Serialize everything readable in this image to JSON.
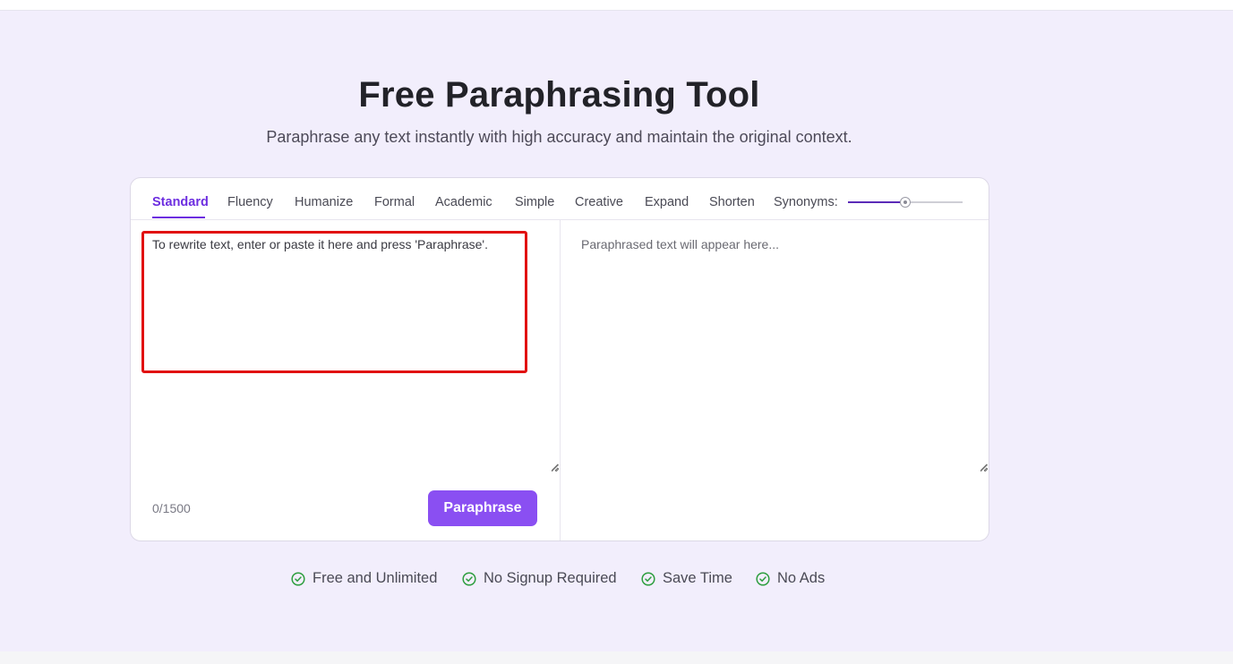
{
  "hero": {
    "title": "Free Paraphrasing Tool",
    "subtitle": "Paraphrase any text instantly with high accuracy and maintain the original context."
  },
  "modes": {
    "items": [
      "Standard",
      "Fluency",
      "Humanize",
      "Formal",
      "Academic",
      "Simple",
      "Creative",
      "Expand",
      "Shorten"
    ],
    "active": "Standard",
    "synonyms_label": "Synonyms:",
    "synonyms_level": 0.5
  },
  "editor": {
    "input_placeholder": "To rewrite text, enter or paste it here and press 'Paraphrase'.",
    "output_placeholder": "Paraphrased text will appear here...",
    "counter": "0/1500",
    "paraphrase_label": "Paraphrase"
  },
  "features": [
    "Free and Unlimited",
    "No Signup Required",
    "Save Time",
    "No Ads"
  ],
  "colors": {
    "accent": "#6d2ee0",
    "button": "#8a4ff2",
    "check": "#2e9e3f",
    "highlight": "#e11010"
  }
}
